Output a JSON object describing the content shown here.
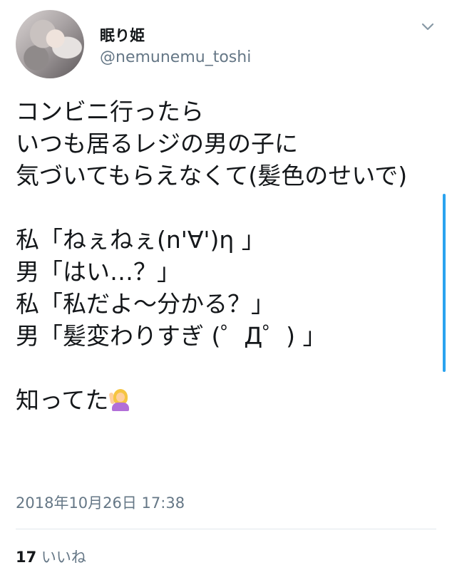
{
  "user": {
    "display_name": "眠り姫",
    "handle": "@nemunemu_toshi"
  },
  "tweet": {
    "text": "コンビニ行ったら\nいつも居るレジの男の子に\n気づいてもらえなくて(髪色のせいで)\n\n私「ねぇねぇ(n'∀')η 」\n男「はい…？」\n私「私だよ〜分かる？」\n男「髪変わりすぎ (゜Д゜) 」\n\n知ってた",
    "emoji": "woman-raising-hand-emoji",
    "timestamp": "2018年10月26日 17:38"
  },
  "stats": {
    "likes_count": "17",
    "likes_label": "いいね"
  },
  "icons": {
    "menu": "chevron-down-icon"
  },
  "colors": {
    "accent": "#2aa3ef",
    "secondary_text": "#657786",
    "primary_text": "#14171a"
  }
}
